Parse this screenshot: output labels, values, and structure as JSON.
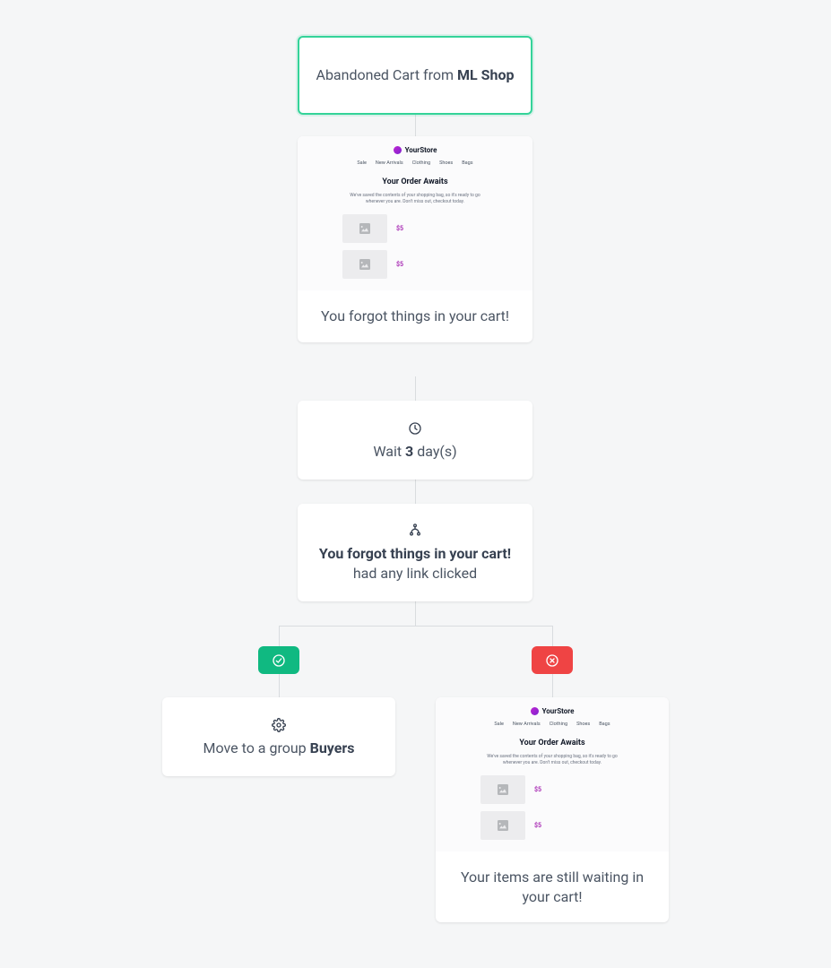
{
  "trigger": {
    "prefix": "Abandoned Cart from ",
    "bold": "ML Shop"
  },
  "email_preview": {
    "brand": "YourStore",
    "nav": [
      "Sale",
      "New Arrivals",
      "Clothing",
      "Shoes",
      "Bags"
    ],
    "headline": "Your Order Awaits",
    "body_line1": "We've saved the contents of your shopping bag, so it's ready to go whenever you are.",
    "body_line2": "Don't miss out, checkout today.",
    "price": "$5"
  },
  "email1": {
    "caption": "You forgot things in your cart!"
  },
  "wait": {
    "prefix": "Wait ",
    "days": "3",
    "suffix": " day(s)"
  },
  "condition": {
    "bold": "You forgot things in your cart!",
    "suffix": " had any link clicked"
  },
  "action_yes": {
    "prefix": "Move to a group ",
    "bold": "Buyers"
  },
  "email2": {
    "caption": "Your items are still waiting in your cart!"
  }
}
